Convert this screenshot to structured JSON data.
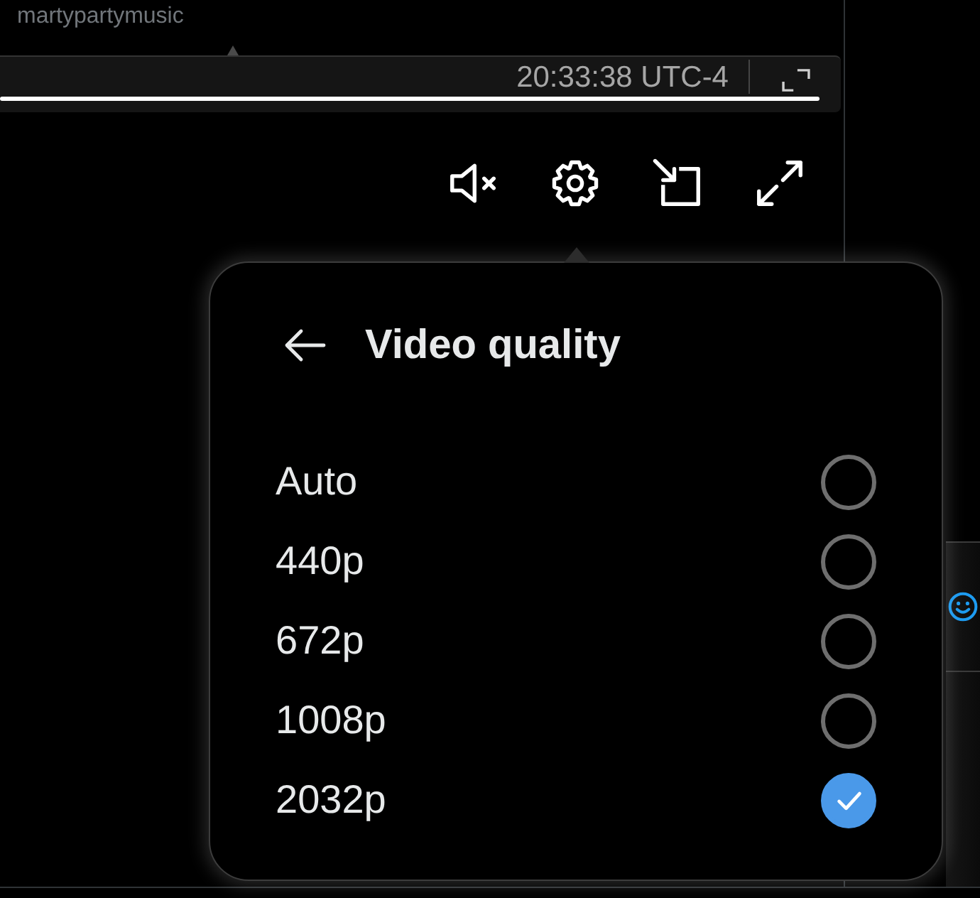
{
  "channel_handle": "martypartymusic",
  "player_bar": {
    "timestamp": "20:33:38 UTC-4"
  },
  "quality_menu": {
    "title": "Video quality",
    "options": [
      {
        "label": "Auto",
        "selected": false
      },
      {
        "label": "440p",
        "selected": false
      },
      {
        "label": "672p",
        "selected": false
      },
      {
        "label": "1008p",
        "selected": false
      },
      {
        "label": "2032p",
        "selected": true
      }
    ]
  }
}
